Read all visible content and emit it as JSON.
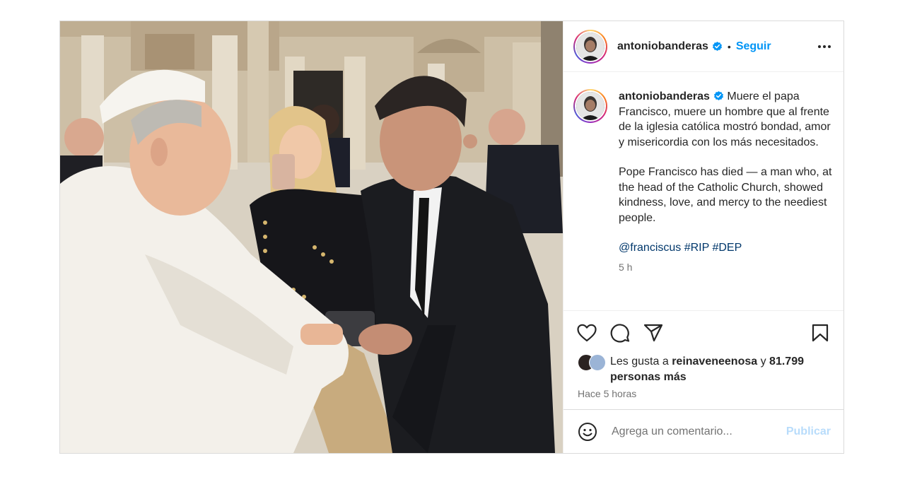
{
  "header": {
    "username": "antoniobanderas",
    "separator": "•",
    "follow_label": "Seguir",
    "avatar_icon": "profile-photo"
  },
  "caption": {
    "username": "antoniobanderas",
    "text_es": "Muere el papa Francisco, muere un hombre que al frente de la iglesia católica mostró bondad, amor y misericordia con los más necesitados.",
    "text_en": "Pope Francisco has died — a man who, at the head of the Catholic Church, showed kindness, love, and mercy to the neediest people.",
    "tags": "@franciscus #RIP #DEP",
    "time": "5 h"
  },
  "actions": {
    "like_icon": "heart-icon",
    "comment_icon": "comment-icon",
    "share_icon": "paper-plane-icon",
    "save_icon": "bookmark-icon"
  },
  "likes": {
    "prefix": "Les gusta a",
    "user": "reinaveneenosa",
    "joiner": "y",
    "count_text": "81.799 personas más"
  },
  "posted_ago": "Hace 5 horas",
  "comment": {
    "placeholder": "Agrega un comentario...",
    "post_label": "Publicar"
  },
  "colors": {
    "accent": "#0095f6",
    "verified": "#0095f6",
    "hashtag": "#00376b",
    "muted": "#737373",
    "post_disabled": "#b8dcfb"
  }
}
